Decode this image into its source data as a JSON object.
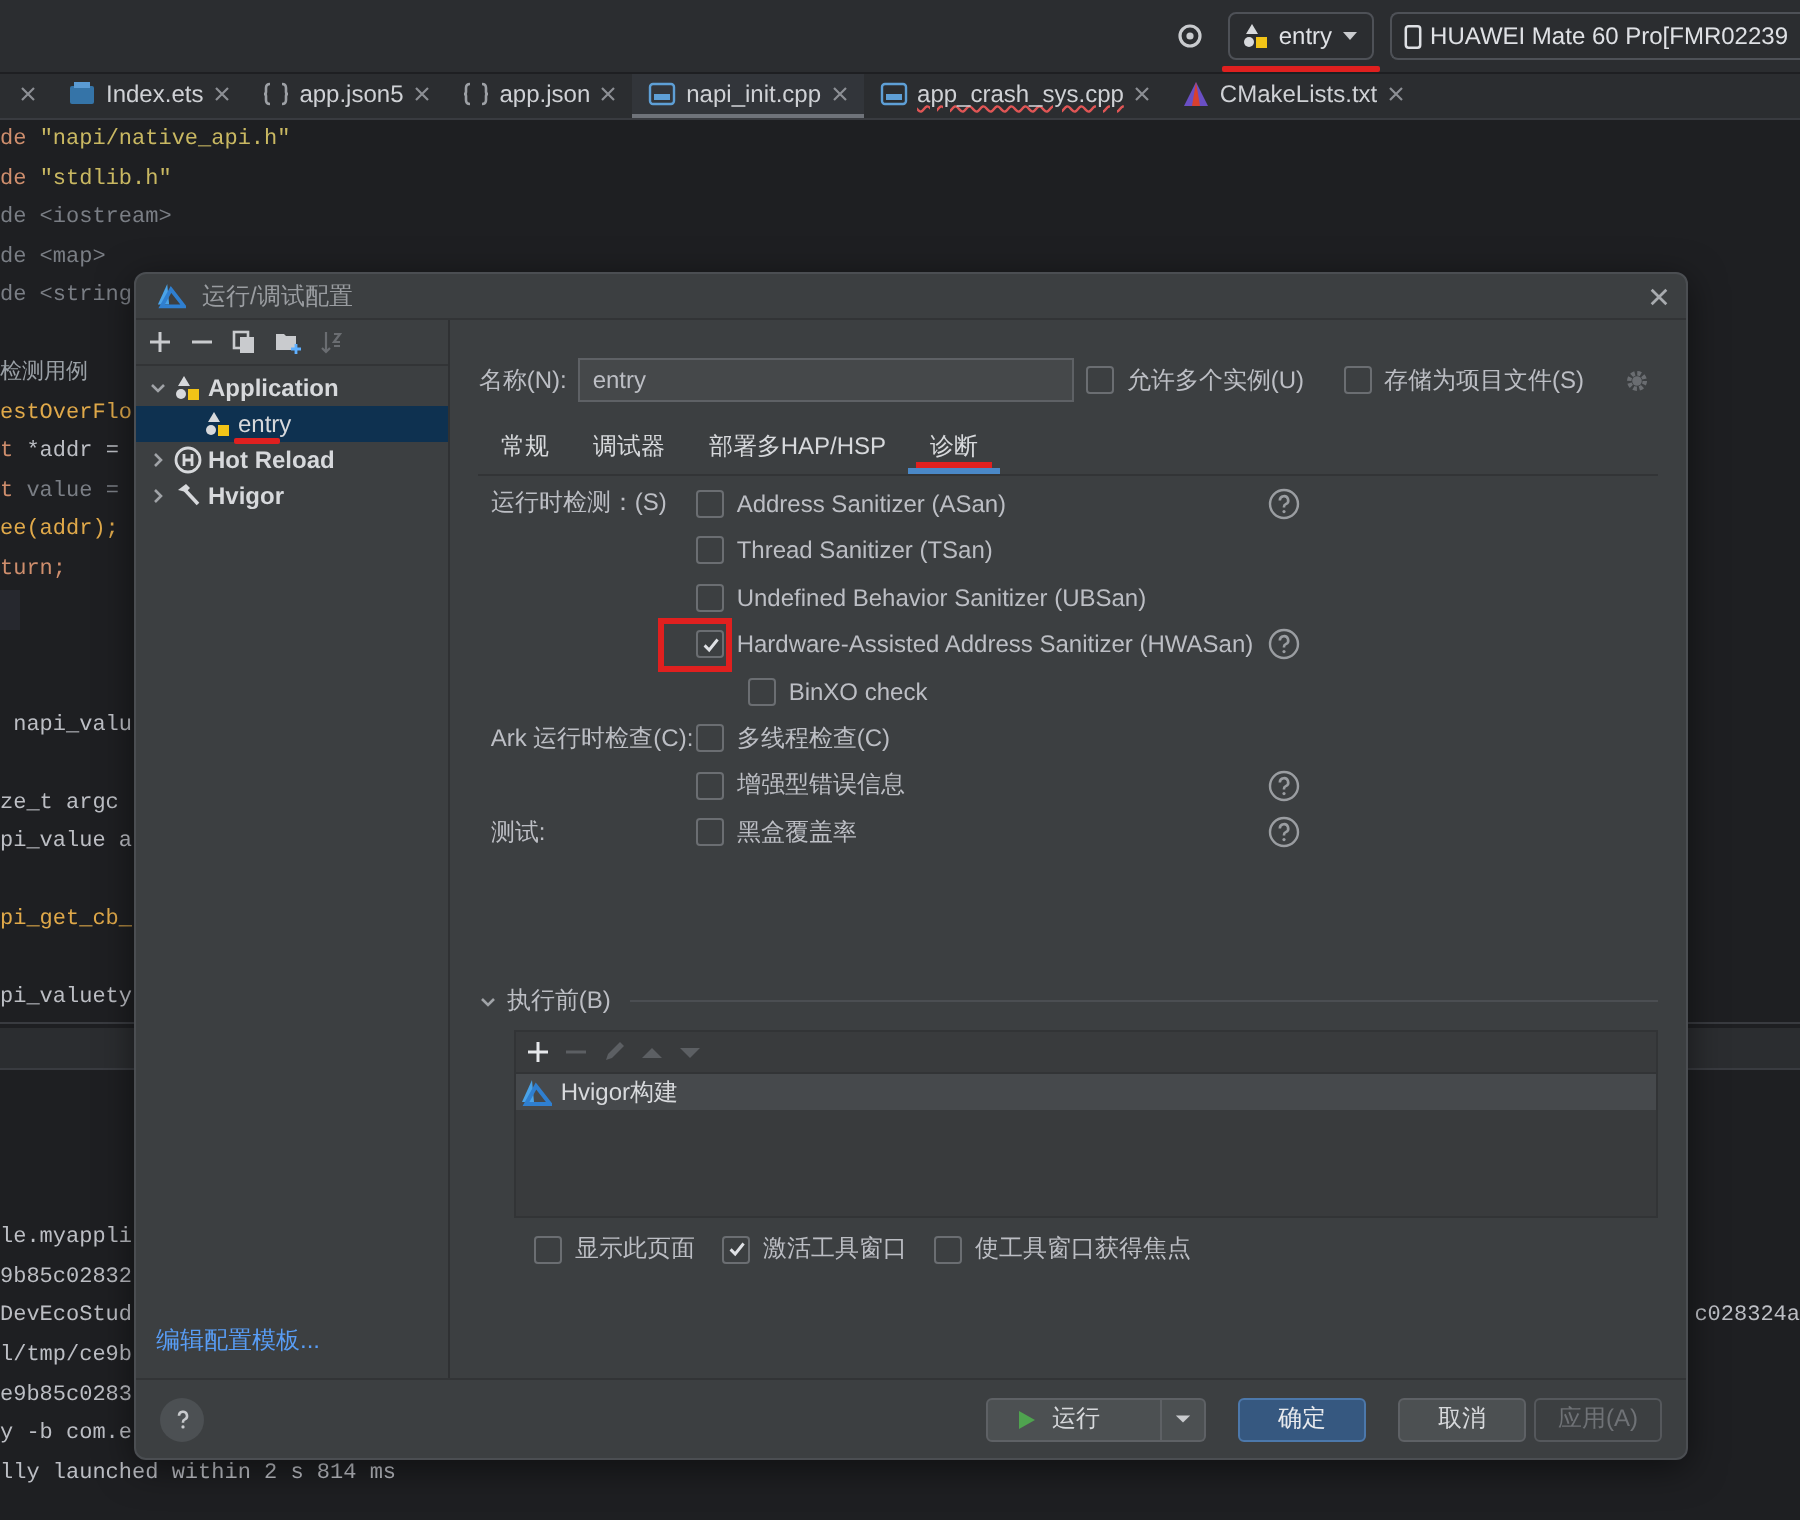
{
  "top_bar": {
    "config": {
      "label": "entry",
      "highlighted": true
    },
    "device": {
      "label": "HUAWEI Mate 60 Pro[FMR02239"
    }
  },
  "editor_tabs": [
    {
      "label": "Index.ets",
      "kind": "ets",
      "selected": false,
      "error": false
    },
    {
      "label": "app.json5",
      "kind": "json",
      "selected": false,
      "error": false
    },
    {
      "label": "app.json",
      "kind": "json",
      "selected": false,
      "error": false
    },
    {
      "label": "napi_init.cpp",
      "kind": "cpp",
      "selected": true,
      "error": false
    },
    {
      "label": "app_crash_sys.cpp",
      "kind": "cpp",
      "selected": false,
      "error": true
    },
    {
      "label": "CMakeLists.txt",
      "kind": "cmake",
      "selected": false,
      "error": false
    }
  ],
  "code_lines": [
    {
      "kind": "code",
      "tokens": [
        {
          "text": "de ",
          "kind": "keyword"
        },
        {
          "text": "\"napi/native_api.h\"",
          "kind": "string"
        }
      ]
    },
    {
      "kind": "code",
      "tokens": [
        {
          "text": "de ",
          "kind": "keyword"
        },
        {
          "text": "\"stdlib.h\"",
          "kind": "string"
        }
      ]
    },
    {
      "kind": "code",
      "tokens": [
        {
          "text": "de <iostream>",
          "kind": "muted"
        }
      ]
    },
    {
      "kind": "code",
      "tokens": [
        {
          "text": "de <map>",
          "kind": "muted"
        }
      ]
    },
    {
      "kind": "code",
      "tokens": [
        {
          "text": "de <string",
          "kind": "muted"
        }
      ]
    },
    {
      "kind": "blank"
    },
    {
      "kind": "code",
      "tokens": [
        {
          "text": "检测用例",
          "kind": "comment"
        }
      ]
    },
    {
      "kind": "code",
      "tokens": [
        {
          "text": "estOverFlo",
          "kind": "function"
        }
      ]
    },
    {
      "kind": "code",
      "tokens": [
        {
          "text": "t",
          "kind": "keyword"
        },
        {
          "text": " *addr =",
          "kind": "plain"
        }
      ]
    },
    {
      "kind": "code",
      "tokens": [
        {
          "text": "t",
          "kind": "keyword"
        },
        {
          "text": " value =",
          "kind": "muted"
        }
      ]
    },
    {
      "kind": "code",
      "tokens": [
        {
          "text": "ee(addr);",
          "kind": "function"
        }
      ]
    },
    {
      "kind": "code",
      "tokens": [
        {
          "text": "turn;",
          "kind": "keyword"
        }
      ]
    },
    {
      "kind": "current"
    },
    {
      "kind": "blank"
    },
    {
      "kind": "blank"
    },
    {
      "kind": "code",
      "tokens": [
        {
          "text": " napi_valu",
          "kind": "plain"
        }
      ]
    },
    {
      "kind": "blank"
    },
    {
      "kind": "code",
      "tokens": [
        {
          "text": "ze_t argc",
          "kind": "plain"
        }
      ]
    },
    {
      "kind": "code",
      "tokens": [
        {
          "text": "pi_value a",
          "kind": "plain"
        }
      ]
    },
    {
      "kind": "blank"
    },
    {
      "kind": "code",
      "tokens": [
        {
          "text": "pi_get_cb_",
          "kind": "function"
        }
      ]
    },
    {
      "kind": "blank"
    },
    {
      "kind": "code",
      "tokens": [
        {
          "text": "pi_valuety",
          "kind": "plain"
        }
      ]
    }
  ],
  "terminal_lines": [
    {
      "text": "le.myappli"
    },
    {
      "text": "9b85c02832"
    },
    {
      "text": "DevEcoStud",
      "tail": "c028324a"
    },
    {
      "text": "l/tmp/ce9b"
    },
    {
      "text": "e9b85c0283"
    },
    {
      "text": "y -b com.e"
    },
    {
      "text": "lly launched within 2 s 814 ms"
    }
  ],
  "dialog": {
    "title": "运行/调试配置",
    "tree": [
      {
        "label": "Application",
        "kind": "app",
        "expanded": true,
        "selected": false,
        "highlighted": false,
        "children": [
          {
            "label": "entry",
            "kind": "app",
            "selected": true,
            "highlighted": true
          }
        ]
      },
      {
        "label": "Hot Reload",
        "kind": "hot",
        "expanded": false,
        "selected": false,
        "highlighted": false
      },
      {
        "label": "Hvigor",
        "kind": "hammer",
        "expanded": false,
        "selected": false,
        "highlighted": false
      }
    ],
    "template_link": "编辑配置模板...",
    "name": {
      "label": "名称(N):",
      "value": "entry"
    },
    "top_options": [
      {
        "label": "允许多个实例(U)",
        "checked": false
      },
      {
        "label": "存储为项目文件(S)",
        "checked": false
      }
    ],
    "tabs": [
      {
        "label": "常规",
        "selected": false,
        "highlighted": false
      },
      {
        "label": "调试器",
        "selected": false,
        "highlighted": false
      },
      {
        "label": "部署多HAP/HSP",
        "selected": false,
        "highlighted": false
      },
      {
        "label": "诊断",
        "selected": true,
        "highlighted": true
      }
    ],
    "groups": [
      {
        "label": "运行时检测：(S)",
        "options": [
          {
            "label": "Address Sanitizer (ASan)",
            "checked": false,
            "help": true,
            "highlighted": false
          },
          {
            "label": "Thread Sanitizer (TSan)",
            "checked": false,
            "help": false,
            "highlighted": false
          },
          {
            "label": "Undefined Behavior Sanitizer (UBSan)",
            "checked": false,
            "help": false,
            "highlighted": false
          },
          {
            "label": "Hardware-Assisted Address Sanitizer (HWASan)",
            "checked": true,
            "help": true,
            "highlighted": true,
            "children": [
              {
                "label": "BinXO check",
                "checked": false,
                "help": false,
                "highlighted": false
              }
            ]
          }
        ]
      },
      {
        "label": "Ark 运行时检查(C):",
        "options": [
          {
            "label": "多线程检查(C)",
            "checked": false,
            "help": false,
            "highlighted": false
          },
          {
            "label": "增强型错误信息",
            "checked": false,
            "help": true,
            "highlighted": false
          }
        ]
      },
      {
        "label": "测试:",
        "options": [
          {
            "label": "黑盒覆盖率",
            "checked": false,
            "help": true,
            "highlighted": false
          }
        ]
      }
    ],
    "before_launch": {
      "title": "执行前(B)",
      "expanded": true,
      "tasks": [
        {
          "label": "Hvigor构建",
          "selected": true
        }
      ]
    },
    "launch_options": [
      {
        "label": "显示此页面",
        "checked": false
      },
      {
        "label": "激活工具窗口",
        "checked": true
      },
      {
        "label": "使工具窗口获得焦点",
        "checked": false
      }
    ],
    "buttons": [
      {
        "label": "运行",
        "kind": "run",
        "disabled": false
      },
      {
        "label": "确定",
        "kind": "primary",
        "disabled": false
      },
      {
        "label": "取消",
        "kind": "normal",
        "disabled": false
      },
      {
        "label": "应用(A)",
        "kind": "normal",
        "disabled": true
      }
    ]
  }
}
